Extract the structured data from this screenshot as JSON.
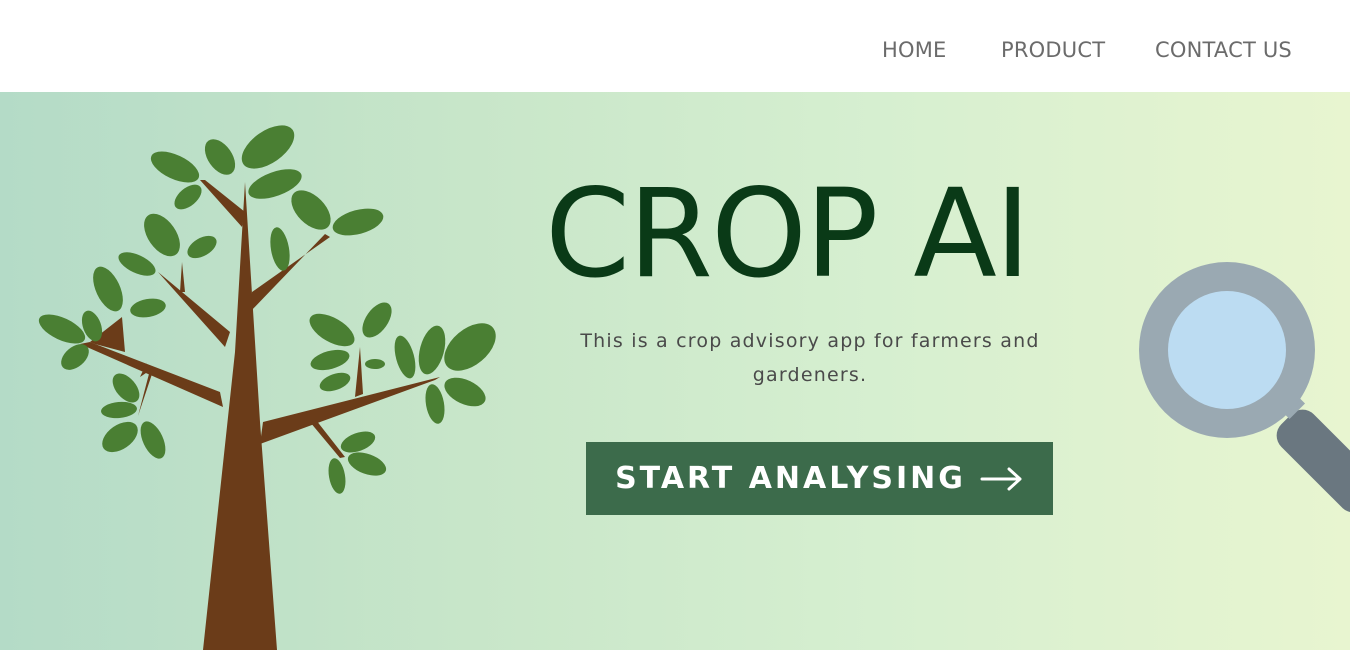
{
  "nav": {
    "home": "HOME",
    "product": "PRODUCT",
    "contact": "CONTACT US"
  },
  "hero": {
    "title": "CROP AI",
    "subtitle": "This is a crop advisory app for farmers and gardeners.",
    "cta_label": "START ANALYSING",
    "cta_icon": "arrow-right-icon",
    "illustration_left": "tree-icon",
    "illustration_right": "magnifying-glass-icon"
  },
  "colors": {
    "title": "#0a3a17",
    "button": "#3c6b4b",
    "trunk": "#6b3c19",
    "leaf": "#4a7f33",
    "lens_ring": "#9aa9b2",
    "lens_glass": "#bcdcf2",
    "handle": "#6a7780",
    "gradient_start": "#b4dbc7",
    "gradient_end": "#e8f5d0"
  }
}
